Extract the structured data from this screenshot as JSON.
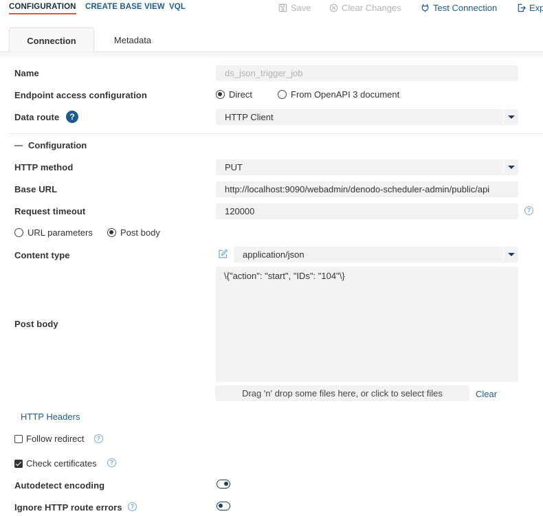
{
  "top_tabs": {
    "configuration": "CONFIGURATION",
    "create_base_view": "CREATE BASE VIEW",
    "vql": "VQL"
  },
  "actions": {
    "save": "Save",
    "clear_changes": "Clear Changes",
    "test_connection": "Test Connection",
    "export": "Exp"
  },
  "tabs": {
    "connection": "Connection",
    "metadata": "Metadata"
  },
  "form": {
    "name_label": "Name",
    "name_value": "ds_json_trigger_job",
    "endpoint_label": "Endpoint access configuration",
    "endpoint_direct": "Direct",
    "endpoint_openapi": "From OpenAPI 3 document",
    "data_route_label": "Data route",
    "data_route_value": "HTTP Client",
    "help_glyph": "?"
  },
  "configuration": {
    "section_title": "Configuration",
    "http_method_label": "HTTP method",
    "http_method_value": "PUT",
    "base_url_label": "Base URL",
    "base_url_value": "http://localhost:9090/webadmin/denodo-scheduler-admin/public/api",
    "request_timeout_label": "Request timeout",
    "request_timeout_value": "120000",
    "url_parameters_label": "URL parameters",
    "post_body_option_label": "Post body",
    "content_type_label": "Content type",
    "content_type_value": "application/json",
    "post_body_label": "Post body",
    "post_body_value": "\\{\"action\": \"start\", \"IDs\": \"104\"\\}",
    "dropzone_text": "Drag 'n' drop some files here, or click to select files",
    "clear_label": "Clear",
    "http_headers_label": "HTTP Headers",
    "follow_redirect_label": "Follow redirect",
    "check_certificates_label": "Check certificates",
    "autodetect_encoding_label": "Autodetect encoding",
    "ignore_http_route_errors_label": "Ignore HTTP route errors"
  },
  "colors": {
    "accent": "#1f5c8c",
    "active_underline": "#e0543c",
    "field_bg": "#f2f2f2",
    "disabled_text": "#b5b5b5"
  }
}
